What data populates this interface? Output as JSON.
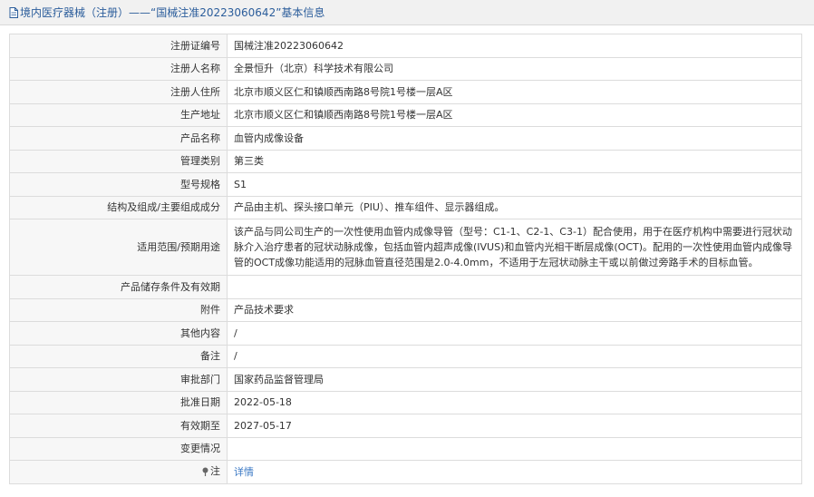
{
  "header": {
    "title": "境内医疗器械（注册）——“国械注准20223060642”基本信息",
    "icon": "document-icon",
    "color": "#2b5d9b"
  },
  "rows": [
    {
      "label": "注册证编号",
      "value": "国械注准20223060642"
    },
    {
      "label": "注册人名称",
      "value": "全景恒升（北京）科学技术有限公司"
    },
    {
      "label": "注册人住所",
      "value": "北京市顺义区仁和镇顺西南路8号院1号楼一层A区"
    },
    {
      "label": "生产地址",
      "value": "北京市顺义区仁和镇顺西南路8号院1号楼一层A区"
    },
    {
      "label": "产品名称",
      "value": "血管内成像设备"
    },
    {
      "label": "管理类别",
      "value": "第三类"
    },
    {
      "label": "型号规格",
      "value": "S1"
    },
    {
      "label": "结构及组成/主要组成成分",
      "value": "产品由主机、探头接口单元（PIU）、推车组件、显示器组成。"
    },
    {
      "label": "适用范围/预期用途",
      "value": "该产品与同公司生产的一次性使用血管内成像导管（型号：C1-1、C2-1、C3-1）配合使用，用于在医疗机构中需要进行冠状动脉介入治疗患者的冠状动脉成像，包括血管内超声成像(IVUS)和血管内光相干断层成像(OCT)。配用的一次性使用血管内成像导管的OCT成像功能适用的冠脉血管直径范围是2.0-4.0mm，不适用于左冠状动脉主干或以前做过旁路手术的目标血管。"
    },
    {
      "label": "产品储存条件及有效期",
      "value": ""
    },
    {
      "label": "附件",
      "value": "产品技术要求"
    },
    {
      "label": "其他内容",
      "value": "/"
    },
    {
      "label": "备注",
      "value": "/"
    },
    {
      "label": "审批部门",
      "value": "国家药品监督管理局"
    },
    {
      "label": "批准日期",
      "value": "2022-05-18"
    },
    {
      "label": "有效期至",
      "value": "2027-05-17"
    },
    {
      "label": "变更情况",
      "value": ""
    }
  ],
  "note": {
    "label": "注",
    "icon": "pin-icon",
    "link_text": "详情",
    "link_color": "#3a78c4"
  }
}
